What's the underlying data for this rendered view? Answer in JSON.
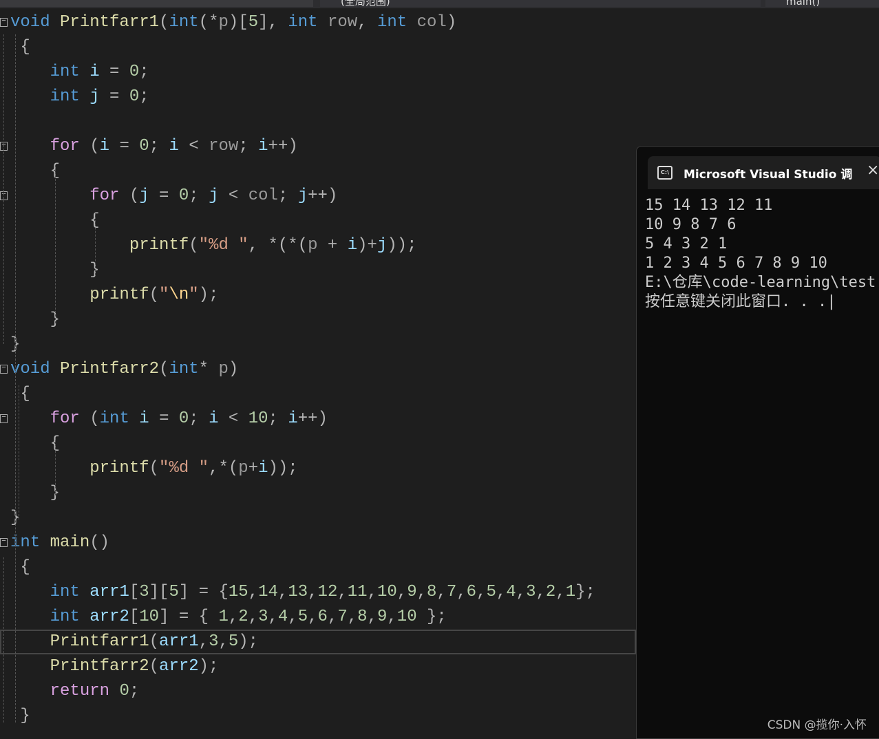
{
  "toolbar": {
    "scope": "(全局范围)",
    "function": "main()"
  },
  "editor": {
    "lines": [
      {
        "fold": true,
        "t": [
          [
            "void",
            "kw"
          ],
          [
            " ",
            "p"
          ],
          [
            "Printfarr1",
            "fn"
          ],
          [
            "(",
            "p"
          ],
          [
            "int",
            "kw"
          ],
          [
            "(*",
            "p"
          ],
          [
            "p",
            "pm"
          ],
          [
            ")[",
            "p"
          ],
          [
            "5",
            "num"
          ],
          [
            "], ",
            "p"
          ],
          [
            "int",
            "kw"
          ],
          [
            " ",
            "p"
          ],
          [
            "row",
            "pm"
          ],
          [
            ", ",
            "p"
          ],
          [
            "int",
            "kw"
          ],
          [
            " ",
            "p"
          ],
          [
            "col",
            "pm"
          ],
          [
            ")",
            "p"
          ]
        ]
      },
      {
        "t": [
          [
            " {",
            "p"
          ]
        ]
      },
      {
        "t": [
          [
            "    ",
            "p"
          ],
          [
            "int",
            "kw"
          ],
          [
            " ",
            "p"
          ],
          [
            "i",
            "var"
          ],
          [
            " = ",
            "p"
          ],
          [
            "0",
            "num"
          ],
          [
            ";",
            "p"
          ]
        ]
      },
      {
        "t": [
          [
            "    ",
            "p"
          ],
          [
            "int",
            "kw"
          ],
          [
            " ",
            "p"
          ],
          [
            "j",
            "var"
          ],
          [
            " = ",
            "p"
          ],
          [
            "0",
            "num"
          ],
          [
            ";",
            "p"
          ]
        ]
      },
      {
        "t": []
      },
      {
        "fold": true,
        "t": [
          [
            "    ",
            "p"
          ],
          [
            "for",
            "ctl"
          ],
          [
            " (",
            "p"
          ],
          [
            "i",
            "var"
          ],
          [
            " = ",
            "p"
          ],
          [
            "0",
            "num"
          ],
          [
            "; ",
            "p"
          ],
          [
            "i",
            "var"
          ],
          [
            " < ",
            "p"
          ],
          [
            "row",
            "pm"
          ],
          [
            "; ",
            "p"
          ],
          [
            "i",
            "var"
          ],
          [
            "++)",
            "p"
          ]
        ]
      },
      {
        "t": [
          [
            "    {",
            "p"
          ]
        ]
      },
      {
        "fold": true,
        "t": [
          [
            "        ",
            "p"
          ],
          [
            "for",
            "ctl"
          ],
          [
            " (",
            "p"
          ],
          [
            "j",
            "var"
          ],
          [
            " = ",
            "p"
          ],
          [
            "0",
            "num"
          ],
          [
            "; ",
            "p"
          ],
          [
            "j",
            "var"
          ],
          [
            " < ",
            "p"
          ],
          [
            "col",
            "pm"
          ],
          [
            "; ",
            "p"
          ],
          [
            "j",
            "var"
          ],
          [
            "++)",
            "p"
          ]
        ]
      },
      {
        "t": [
          [
            "        {",
            "p"
          ]
        ]
      },
      {
        "t": [
          [
            "            ",
            "p"
          ],
          [
            "printf",
            "fn"
          ],
          [
            "(",
            "p"
          ],
          [
            "\"%d \"",
            "str"
          ],
          [
            ", *(*(",
            "p"
          ],
          [
            "p",
            "pm"
          ],
          [
            " + ",
            "p"
          ],
          [
            "i",
            "var"
          ],
          [
            ")+",
            "p"
          ],
          [
            "j",
            "var"
          ],
          [
            "));",
            "p"
          ]
        ]
      },
      {
        "t": [
          [
            "        }",
            "p"
          ]
        ]
      },
      {
        "t": [
          [
            "        ",
            "p"
          ],
          [
            "printf",
            "fn"
          ],
          [
            "(",
            "p"
          ],
          [
            "\"",
            "str"
          ],
          [
            "\\n",
            "esc"
          ],
          [
            "\"",
            "str"
          ],
          [
            ");",
            "p"
          ]
        ]
      },
      {
        "t": [
          [
            "    }",
            "p"
          ]
        ]
      },
      {
        "t": [
          [
            "}",
            "p"
          ]
        ]
      },
      {
        "fold": true,
        "t": [
          [
            "void",
            "kw"
          ],
          [
            " ",
            "p"
          ],
          [
            "Printfarr2",
            "fn"
          ],
          [
            "(",
            "p"
          ],
          [
            "int",
            "kw"
          ],
          [
            "* ",
            "p"
          ],
          [
            "p",
            "pm"
          ],
          [
            ")",
            "p"
          ]
        ]
      },
      {
        "t": [
          [
            " {",
            "p"
          ]
        ]
      },
      {
        "fold": true,
        "t": [
          [
            "    ",
            "p"
          ],
          [
            "for",
            "ctl"
          ],
          [
            " (",
            "p"
          ],
          [
            "int",
            "kw"
          ],
          [
            " ",
            "p"
          ],
          [
            "i",
            "var"
          ],
          [
            " = ",
            "p"
          ],
          [
            "0",
            "num"
          ],
          [
            "; ",
            "p"
          ],
          [
            "i",
            "var"
          ],
          [
            " < ",
            "p"
          ],
          [
            "10",
            "num"
          ],
          [
            "; ",
            "p"
          ],
          [
            "i",
            "var"
          ],
          [
            "++)",
            "p"
          ]
        ]
      },
      {
        "t": [
          [
            "    {",
            "p"
          ]
        ]
      },
      {
        "t": [
          [
            "        ",
            "p"
          ],
          [
            "printf",
            "fn"
          ],
          [
            "(",
            "p"
          ],
          [
            "\"%d \"",
            "str"
          ],
          [
            ",*(",
            "p"
          ],
          [
            "p",
            "pm"
          ],
          [
            "+",
            "p"
          ],
          [
            "i",
            "var"
          ],
          [
            "));",
            "p"
          ]
        ]
      },
      {
        "t": [
          [
            "    }",
            "p"
          ]
        ]
      },
      {
        "t": [
          [
            "}",
            "p"
          ]
        ]
      },
      {
        "fold": true,
        "t": [
          [
            "int",
            "kw"
          ],
          [
            " ",
            "p"
          ],
          [
            "main",
            "fn"
          ],
          [
            "()",
            "p"
          ]
        ]
      },
      {
        "t": [
          [
            " {",
            "p"
          ]
        ]
      },
      {
        "t": [
          [
            "    ",
            "p"
          ],
          [
            "int",
            "kw"
          ],
          [
            " ",
            "p"
          ],
          [
            "arr1",
            "var"
          ],
          [
            "[",
            "p"
          ],
          [
            "3",
            "num"
          ],
          [
            "][",
            "p"
          ],
          [
            "5",
            "num"
          ],
          [
            "] = {",
            "p"
          ],
          [
            "15",
            "num"
          ],
          [
            ",",
            "p"
          ],
          [
            "14",
            "num"
          ],
          [
            ",",
            "p"
          ],
          [
            "13",
            "num"
          ],
          [
            ",",
            "p"
          ],
          [
            "12",
            "num"
          ],
          [
            ",",
            "p"
          ],
          [
            "11",
            "num"
          ],
          [
            ",",
            "p"
          ],
          [
            "10",
            "num"
          ],
          [
            ",",
            "p"
          ],
          [
            "9",
            "num"
          ],
          [
            ",",
            "p"
          ],
          [
            "8",
            "num"
          ],
          [
            ",",
            "p"
          ],
          [
            "7",
            "num"
          ],
          [
            ",",
            "p"
          ],
          [
            "6",
            "num"
          ],
          [
            ",",
            "p"
          ],
          [
            "5",
            "num"
          ],
          [
            ",",
            "p"
          ],
          [
            "4",
            "num"
          ],
          [
            ",",
            "p"
          ],
          [
            "3",
            "num"
          ],
          [
            ",",
            "p"
          ],
          [
            "2",
            "num"
          ],
          [
            ",",
            "p"
          ],
          [
            "1",
            "num"
          ],
          [
            "};",
            "p"
          ]
        ]
      },
      {
        "t": [
          [
            "    ",
            "p"
          ],
          [
            "int",
            "kw"
          ],
          [
            " ",
            "p"
          ],
          [
            "arr2",
            "var"
          ],
          [
            "[",
            "p"
          ],
          [
            "10",
            "num"
          ],
          [
            "] = { ",
            "p"
          ],
          [
            "1",
            "num"
          ],
          [
            ",",
            "p"
          ],
          [
            "2",
            "num"
          ],
          [
            ",",
            "p"
          ],
          [
            "3",
            "num"
          ],
          [
            ",",
            "p"
          ],
          [
            "4",
            "num"
          ],
          [
            ",",
            "p"
          ],
          [
            "5",
            "num"
          ],
          [
            ",",
            "p"
          ],
          [
            "6",
            "num"
          ],
          [
            ",",
            "p"
          ],
          [
            "7",
            "num"
          ],
          [
            ",",
            "p"
          ],
          [
            "8",
            "num"
          ],
          [
            ",",
            "p"
          ],
          [
            "9",
            "num"
          ],
          [
            ",",
            "p"
          ],
          [
            "10",
            "num"
          ],
          [
            " };",
            "p"
          ]
        ]
      },
      {
        "hl": true,
        "t": [
          [
            "    ",
            "p"
          ],
          [
            "Printfarr1",
            "fn"
          ],
          [
            "(",
            "p"
          ],
          [
            "arr1",
            "var"
          ],
          [
            ",",
            "p"
          ],
          [
            "3",
            "num"
          ],
          [
            ",",
            "p"
          ],
          [
            "5",
            "num"
          ],
          [
            ");",
            "p"
          ]
        ]
      },
      {
        "t": [
          [
            "    ",
            "p"
          ],
          [
            "Printfarr2",
            "fn"
          ],
          [
            "(",
            "p"
          ],
          [
            "arr2",
            "var"
          ],
          [
            ");",
            "p"
          ]
        ]
      },
      {
        "t": [
          [
            "    ",
            "p"
          ],
          [
            "return",
            "ctl"
          ],
          [
            " ",
            "p"
          ],
          [
            "0",
            "num"
          ],
          [
            ";",
            "p"
          ]
        ]
      },
      {
        "t": [
          [
            " }",
            "p"
          ]
        ]
      }
    ]
  },
  "console": {
    "title": "Microsoft Visual Studio 调试控制台",
    "icon": "terminal-icon",
    "icon_label": "C:\\",
    "close": "×",
    "output": [
      "15 14 13 12 11",
      "10 9 8 7 6",
      "5 4 3 2 1",
      "1 2 3 4 5 6 7 8 9 10",
      "E:\\仓库\\code-learning\\test",
      "按任意键关闭此窗口. . .|"
    ]
  },
  "watermark": "CSDN @揽你·入怀"
}
